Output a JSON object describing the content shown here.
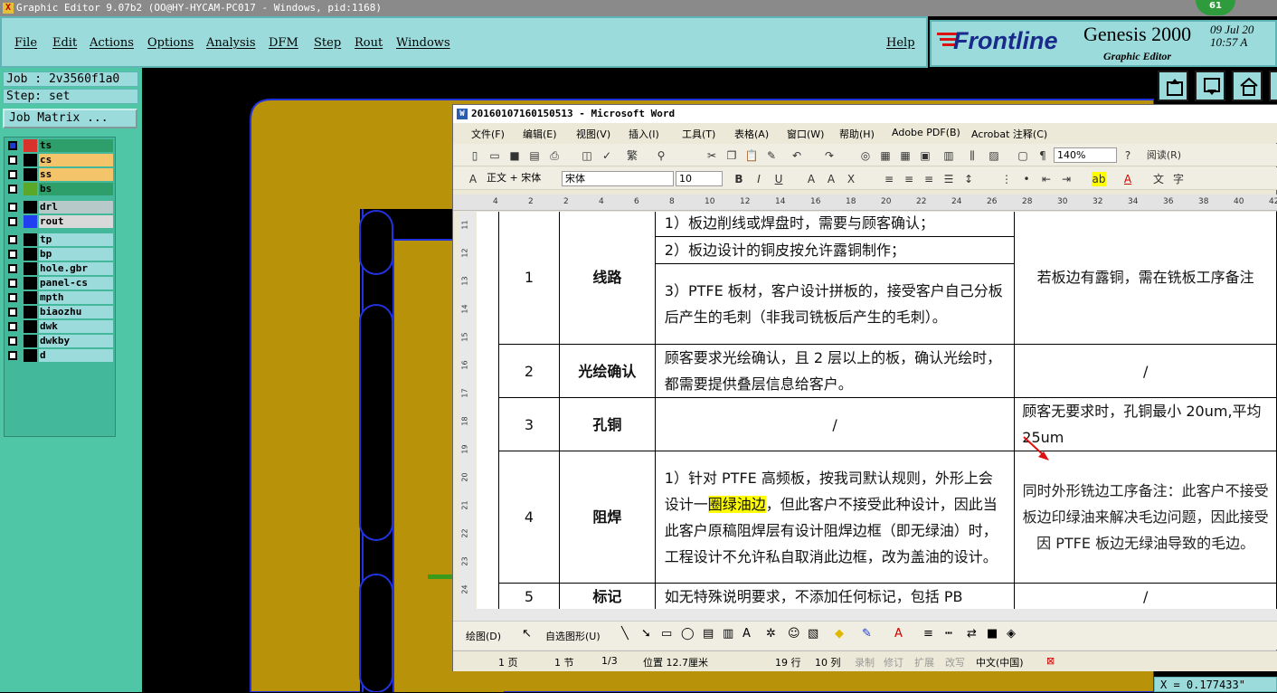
{
  "app": {
    "title": "Graphic Editor 9.07b2 (OO@HY-HYCAM-PC017 - Windows, pid:1168)",
    "badge": "61",
    "menu": [
      "File",
      "Edit",
      "Actions",
      "Options",
      "Analysis",
      "DFM",
      "Step",
      "Rout",
      "Windows"
    ],
    "help": "Help",
    "brand": "Frontline",
    "product": "Genesis 2000",
    "product_sub": "Graphic Editor",
    "date": "09 Jul 20",
    "time": "10:57 A"
  },
  "job": {
    "label": "Job : 2v3560f1a0",
    "step": "Step: set",
    "matrix_button": "Job Matrix ..."
  },
  "layers": [
    {
      "name": "ts",
      "color": "#d9342b",
      "bg": "#2e9f6b",
      "checked": true
    },
    {
      "name": "cs",
      "color": "#000000",
      "bg": "#f4c46a",
      "checked": false
    },
    {
      "name": "ss",
      "color": "#000000",
      "bg": "#f4c46a",
      "checked": false
    },
    {
      "name": "bs",
      "color": "#5aa82a",
      "bg": "#2e9f6b",
      "checked": false
    },
    {
      "name": "drl",
      "color": "#000000",
      "bg": "#b8c9c9",
      "checked": false
    },
    {
      "name": "rout",
      "color": "#1f3ff0",
      "bg": "#d9d9d9",
      "checked": false
    },
    {
      "name": "tp",
      "color": "#000000",
      "bg": "#9cdbdb",
      "checked": false
    },
    {
      "name": "bp",
      "color": "#000000",
      "bg": "#9cdbdb",
      "checked": false
    },
    {
      "name": "hole.gbr",
      "color": "#000000",
      "bg": "#9cdbdb",
      "checked": false
    },
    {
      "name": "panel-cs",
      "color": "#000000",
      "bg": "#9cdbdb",
      "checked": false
    },
    {
      "name": "mpth",
      "color": "#000000",
      "bg": "#9cdbdb",
      "checked": false
    },
    {
      "name": "biaozhu",
      "color": "#000000",
      "bg": "#9cdbdb",
      "checked": false
    },
    {
      "name": "dwk",
      "color": "#000000",
      "bg": "#9cdbdb",
      "checked": false
    },
    {
      "name": "dwkby",
      "color": "#000000",
      "bg": "#9cdbdb",
      "checked": false
    },
    {
      "name": "d",
      "color": "#000000",
      "bg": "#9cdbdb",
      "checked": false
    }
  ],
  "coord": "X = 0.177433\"",
  "word": {
    "title": "20160107160150513 - Microsoft Word",
    "menu": [
      "文件(F)",
      "编辑(E)",
      "视图(V)",
      "插入(I)",
      "工具(T)",
      "表格(A)",
      "窗口(W)",
      "帮助(H)",
      "Adobe PDF(B)",
      "Acrobat 注释(C)"
    ],
    "zoom": "140%",
    "read": "阅读(R)",
    "style": "正文 + 宋体",
    "font": "宋体",
    "size": "10",
    "ruler": [
      "4",
      "2",
      "2",
      "4",
      "6",
      "8",
      "10",
      "12",
      "14",
      "16",
      "18",
      "20",
      "22",
      "24",
      "26",
      "28",
      "30",
      "32",
      "34",
      "36",
      "38",
      "40",
      "42"
    ],
    "vruler": [
      "11",
      "12",
      "13",
      "14",
      "15",
      "16",
      "17",
      "18",
      "19",
      "20",
      "21",
      "22",
      "23",
      "24"
    ],
    "rows": [
      {
        "no": "1",
        "item": "线路",
        "req": [
          "1）板边削线或焊盘时，需要与顾客确认；",
          "2）板边设计的铜皮按允许露铜制作；",
          "3）PTFE 板材，客户设计拼板的，接受客户自己分板后产生的毛刺（非我司铣板后产生的毛刺）。"
        ],
        "note": "若板边有露铜，需在铣板工序备注"
      },
      {
        "no": "2",
        "item": "光绘确认",
        "req": "顾客要求光绘确认，且 2 层以上的板，确认光绘时，都需要提供叠层信息给客户。",
        "note": "/"
      },
      {
        "no": "3",
        "item": "孔铜",
        "req": "/",
        "note": "顾客无要求时，孔铜最小 20um,平均 25um"
      },
      {
        "no": "4",
        "item": "阻焊",
        "req_a": "1）针对 PTFE 高频板，按我司默认规则，外形上会设计一",
        "req_hl": "圈绿油边",
        "req_b": "，但此客户不接受此种设计，因此当此客户原稿阻焊层有设计阻焊边框（即无绿油）时，工程设计不允许私自取消此边框，改为盖油的设计。",
        "note": "同时外形铣边工序备注：此客户不接受板边印绿油来解决毛边问题，因此接受因 PTFE 板边无绿油导致的毛边。"
      },
      {
        "no": "5",
        "item": "标记",
        "req": "如无特殊说明要求，不添加任何标记，包括 PB",
        "note": "/"
      }
    ],
    "draw_label": "绘图(D)",
    "autoshape": "自选图形(U)",
    "status": {
      "page": "1 页",
      "section": "1 节",
      "pages": "1/3",
      "pos": "位置 12.7厘米",
      "line": "19 行",
      "col": "10 列",
      "rec": "录制",
      "trk": "修订",
      "ext": "扩展",
      "ovr": "改写",
      "lang": "中文(中国)"
    }
  }
}
